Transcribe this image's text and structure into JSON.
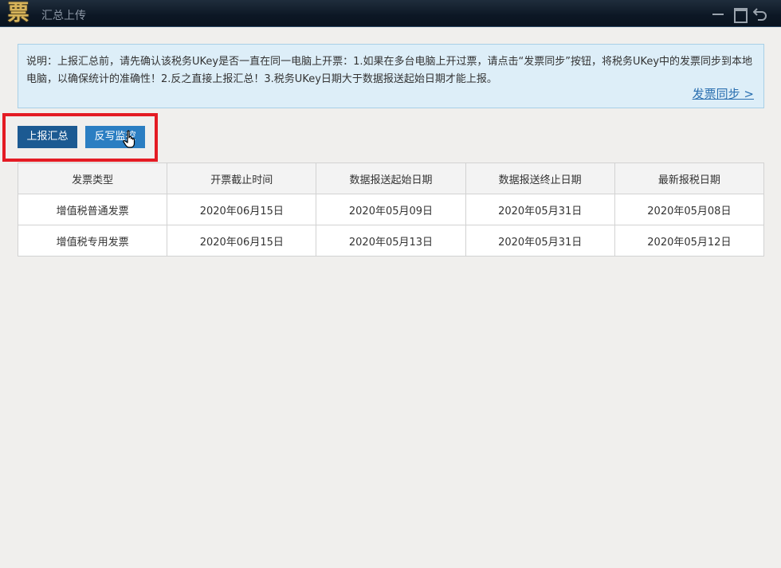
{
  "window": {
    "logo_glyph": "票",
    "title": "汇总上传"
  },
  "notice": {
    "text": "说明：上报汇总前，请先确认该税务UKey是否一直在同一电脑上开票：1.如果在多台电脑上开过票，请点击“发票同步”按钮，将税务UKey中的发票同步到本地电脑，以确保统计的准确性！2.反之直接上报汇总！3.税务UKey日期大于数据报送起始日期才能上报。",
    "sync_link": "发票同步 >"
  },
  "toolbar": {
    "upload_label": "上报汇总",
    "writeback_label": "反写监控"
  },
  "table": {
    "headers": [
      "发票类型",
      "开票截止时间",
      "数据报送起始日期",
      "数据报送终止日期",
      "最新报税日期"
    ],
    "rows": [
      [
        "增值税普通发票",
        "2020年06月15日",
        "2020年05月09日",
        "2020年05月31日",
        "2020年05月08日"
      ],
      [
        "增值税专用发票",
        "2020年06月15日",
        "2020年05月13日",
        "2020年05月31日",
        "2020年05月12日"
      ]
    ]
  }
}
